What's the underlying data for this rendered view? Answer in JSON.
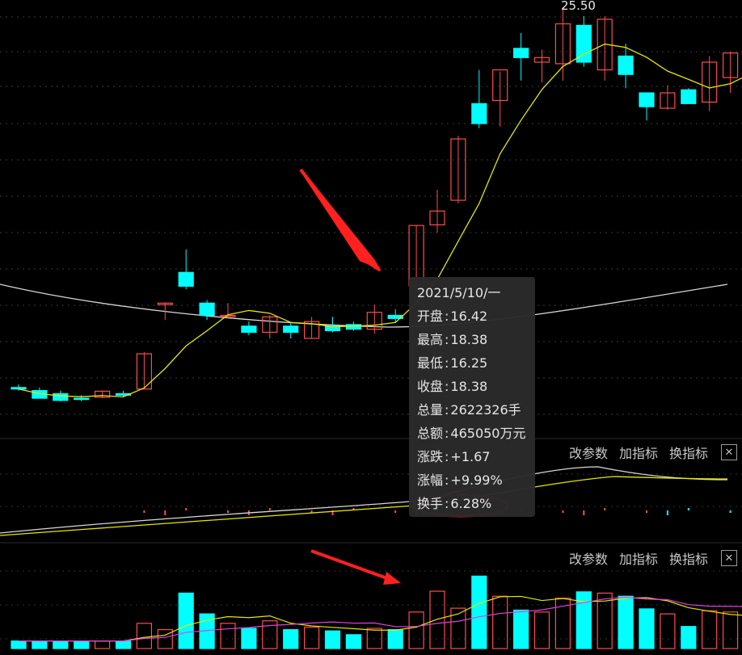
{
  "max_price_label": "25.50",
  "tooltip": {
    "date": "2021/5/10/一",
    "rows": [
      {
        "label": "开盘",
        "value": "16.42"
      },
      {
        "label": "最高",
        "value": "18.38"
      },
      {
        "label": "最低",
        "value": "16.25"
      },
      {
        "label": "收盘",
        "value": "18.38"
      },
      {
        "label": "总量",
        "value": "2622326手"
      },
      {
        "label": "总额",
        "value": "465050万元"
      },
      {
        "label": "涨跌",
        "value": "+1.67"
      },
      {
        "label": "涨幅",
        "value": "+9.99%"
      },
      {
        "label": "换手",
        "value": "6.28%"
      }
    ]
  },
  "panel_toolbar": {
    "edit_params": "改参数",
    "add_indicator": "加指标",
    "switch_indicator": "换指标",
    "close": "✕"
  },
  "colors": {
    "up": "#ff4d4d",
    "down": "#00ffff",
    "ma_yellow": "#e6e600",
    "ma_white": "#d8d8d8",
    "ma_magenta": "#e040e0",
    "annotation_red": "#ff2020"
  },
  "chart_data": {
    "type": "candlestick",
    "candles": [
      {
        "open": 13.1,
        "high": 13.2,
        "low": 13.0,
        "close": 13.05,
        "vol_bar": 12
      },
      {
        "open": 13.0,
        "high": 13.1,
        "low": 12.8,
        "close": 12.75,
        "vol_bar": 12
      },
      {
        "open": 12.9,
        "high": 13.0,
        "low": 12.65,
        "close": 12.68,
        "vol_bar": 12
      },
      {
        "open": 12.75,
        "high": 12.85,
        "low": 12.65,
        "close": 12.72,
        "vol_bar": 12
      },
      {
        "open": 12.78,
        "high": 13.0,
        "low": 12.75,
        "close": 12.98,
        "vol_bar": 12
      },
      {
        "open": 12.9,
        "high": 13.0,
        "low": 12.8,
        "close": 12.85,
        "vol_bar": 12
      },
      {
        "open": 13.05,
        "high": 14.25,
        "low": 13.05,
        "close": 14.2,
        "vol_bar": 40
      },
      {
        "open": 15.8,
        "high": 15.85,
        "low": 15.3,
        "close": 15.85,
        "vol_bar": 30
      },
      {
        "open": 16.85,
        "high": 17.6,
        "low": 16.3,
        "close": 16.4,
        "vol_bar": 88
      },
      {
        "open": 15.85,
        "high": 15.95,
        "low": 15.3,
        "close": 15.45,
        "vol_bar": 55
      },
      {
        "open": 15.45,
        "high": 15.85,
        "low": 15.35,
        "close": 15.45,
        "vol_bar": 40
      },
      {
        "open": 15.1,
        "high": 15.25,
        "low": 14.8,
        "close": 14.9,
        "vol_bar": 32
      },
      {
        "open": 14.9,
        "high": 15.45,
        "low": 14.7,
        "close": 15.4,
        "vol_bar": 44
      },
      {
        "open": 15.1,
        "high": 15.2,
        "low": 14.7,
        "close": 14.9,
        "vol_bar": 30
      },
      {
        "open": 14.7,
        "high": 15.4,
        "low": 14.7,
        "close": 15.25,
        "vol_bar": 34
      },
      {
        "open": 15.1,
        "high": 15.4,
        "low": 14.9,
        "close": 14.95,
        "vol_bar": 28
      },
      {
        "open": 15.15,
        "high": 15.25,
        "low": 14.95,
        "close": 15.0,
        "vol_bar": 22
      },
      {
        "open": 15.0,
        "high": 15.8,
        "low": 14.85,
        "close": 15.55,
        "vol_bar": 32
      },
      {
        "open": 15.45,
        "high": 15.65,
        "low": 15.2,
        "close": 15.35,
        "vol_bar": 30
      },
      {
        "open": 16.42,
        "high": 18.38,
        "low": 16.25,
        "close": 18.38,
        "vol_bar": 58
      },
      {
        "open": 18.4,
        "high": 19.55,
        "low": 18.15,
        "close": 18.85,
        "vol_bar": 91
      },
      {
        "open": 19.2,
        "high": 21.3,
        "low": 19.1,
        "close": 21.2,
        "vol_bar": 64
      },
      {
        "open": 22.35,
        "high": 23.45,
        "low": 21.55,
        "close": 21.7,
        "vol_bar": 115
      },
      {
        "open": 22.45,
        "high": 23.4,
        "low": 21.6,
        "close": 23.45,
        "vol_bar": 83
      },
      {
        "open": 24.15,
        "high": 24.65,
        "low": 23.1,
        "close": 23.85,
        "vol_bar": 61
      },
      {
        "open": 23.7,
        "high": 24.1,
        "low": 23.05,
        "close": 23.85,
        "vol_bar": 58
      },
      {
        "open": 23.65,
        "high": 25.5,
        "low": 23.1,
        "close": 24.95,
        "vol_bar": 80
      },
      {
        "open": 24.9,
        "high": 25.2,
        "low": 23.55,
        "close": 23.7,
        "vol_bar": 90
      },
      {
        "open": 23.45,
        "high": 25.2,
        "low": 23.1,
        "close": 25.1,
        "vol_bar": 88
      },
      {
        "open": 23.9,
        "high": 24.3,
        "low": 22.85,
        "close": 23.3,
        "vol_bar": 83
      },
      {
        "open": 22.7,
        "high": 22.7,
        "low": 21.8,
        "close": 22.25,
        "vol_bar": 63
      },
      {
        "open": 22.2,
        "high": 22.95,
        "low": 22.15,
        "close": 22.7,
        "vol_bar": 55
      },
      {
        "open": 22.8,
        "high": 22.85,
        "low": 22.35,
        "close": 22.35,
        "vol_bar": 35
      },
      {
        "open": 22.4,
        "high": 23.9,
        "low": 22.1,
        "close": 23.7,
        "vol_bar": 60
      },
      {
        "open": 23.2,
        "high": 24.05,
        "low": 22.7,
        "close": 24.0,
        "vol_bar": 58
      },
      {
        "open": 23.7,
        "high": 24.85,
        "low": 23.4,
        "close": 23.95,
        "vol_bar": 52
      }
    ]
  }
}
